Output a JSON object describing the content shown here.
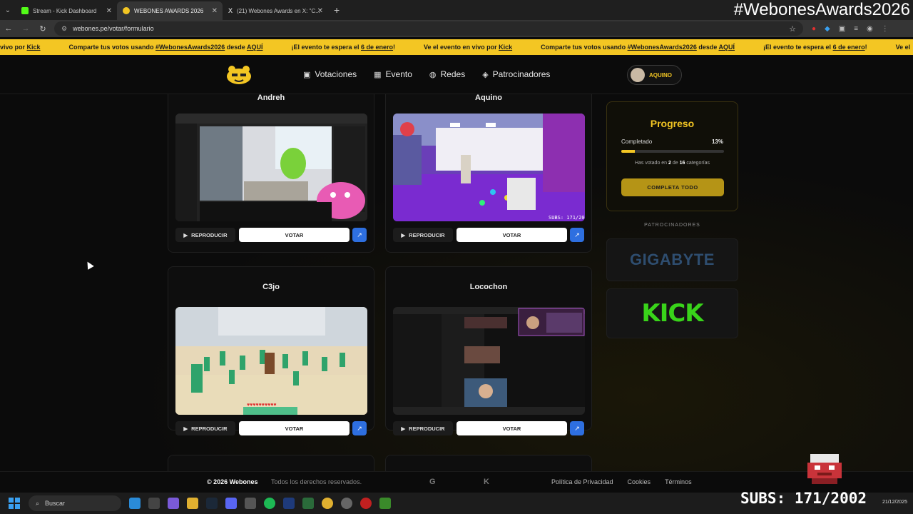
{
  "browser": {
    "tabs": [
      {
        "label": "Stream - Kick Dashboard",
        "color": "#53fc18"
      },
      {
        "label": "WEBONES AWARDS 2026",
        "color": "#f3c623"
      },
      {
        "label": "(21) Webones Awards en X: \"C...",
        "color": "#ffffff"
      }
    ],
    "url": "webones.pe/votar/formulario"
  },
  "overlay": {
    "hashtag": "#WebonesAwards2026",
    "subs": "SUBS: 171/2002"
  },
  "marquee": {
    "items": [
      {
        "pre": "vivo por ",
        "link": "Kick",
        "post": ""
      },
      {
        "pre": "Comparte tus votos usando ",
        "link": "#WebonesAwards2026",
        "mid": " desde ",
        "link2": "AQUÍ"
      },
      {
        "pre": "¡El evento te espera el ",
        "link": "6 de enero",
        "post": "!"
      },
      {
        "pre": "Ve el evento en vivo por ",
        "link": "Kick",
        "post": ""
      },
      {
        "pre": "Comparte tus votos usando ",
        "link": "#WebonesAwards2026",
        "mid": " desde ",
        "link2": "AQUÍ"
      },
      {
        "pre": "¡El evento te espera el ",
        "link": "6 de enero",
        "post": "!"
      },
      {
        "pre": "Ve el ",
        "link": "",
        "post": ""
      }
    ]
  },
  "nav": {
    "links": [
      "Votaciones",
      "Evento",
      "Redes",
      "Patrocinadores"
    ],
    "user": "AQUINO"
  },
  "cards": [
    {
      "name": "Andreh",
      "play": "REPRODUCIR",
      "vote": "VOTAR"
    },
    {
      "name": "Aquino",
      "play": "REPRODUCIR",
      "vote": "VOTAR"
    },
    {
      "name": "C3jo",
      "play": "REPRODUCIR",
      "vote": "VOTAR"
    },
    {
      "name": "Locochon",
      "play": "REPRODUCIR",
      "vote": "VOTAR"
    }
  ],
  "progress": {
    "title": "Progreso",
    "label": "Completado",
    "percent_text": "13%",
    "percent": 13,
    "note_pre": "Has votado en ",
    "voted": "2",
    "note_mid": " de ",
    "total": "16",
    "note_post": " categorías",
    "cta": "COMPLETA TODO"
  },
  "sponsors": {
    "label": "PATROCINADORES",
    "items": [
      "GIGABYTE",
      "KICK"
    ]
  },
  "footer": {
    "copyright": "© 2026 Webones",
    "rights": "Todos los derechos reservados.",
    "links": [
      "Política de Privacidad",
      "Cookies",
      "Términos"
    ]
  },
  "taskbar": {
    "search": "Buscar",
    "date": "21/12/2025"
  }
}
